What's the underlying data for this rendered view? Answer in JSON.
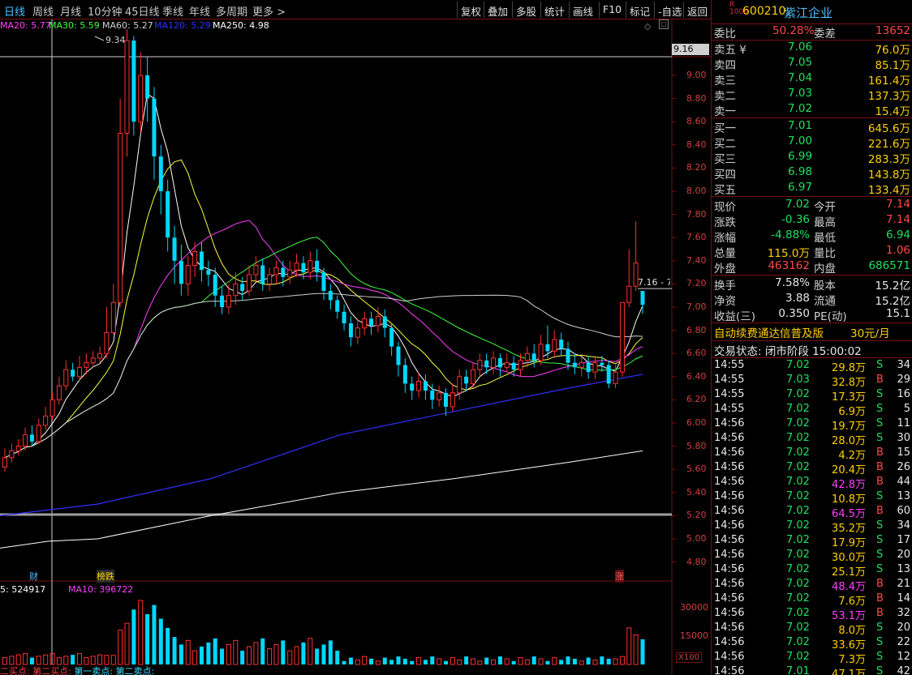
{
  "toolbar": {
    "periods": [
      "日线",
      "周线",
      "月线",
      "10分钟",
      "45日线",
      "季线",
      "年线",
      "多周期",
      "更多 >"
    ],
    "buttons": [
      "复权",
      "叠加",
      "多股",
      "统计",
      "画线",
      "F10",
      "标记",
      "-自选",
      "返回"
    ]
  },
  "ma_legend": {
    "ma20": "MA20: 5.77",
    "ma30": "MA30: 5.59",
    "ma60": "MA60: 5.27",
    "ma120": "MA120: 5.29",
    "ma250": "MA250: 4.98"
  },
  "chart_labels": {
    "high_mark": "9.34",
    "price_cursor": "9.16",
    "last_price_tag": "7.16 - 7",
    "event_cai": "财",
    "event_bang": "榜跌",
    "event_zhang": "涨",
    "vol_legend_ma5": "5: 524917",
    "vol_legend_ma10": "MA10: 396722",
    "vol_unit": "X100",
    "bottom_signals": [
      "二买点:",
      "第二买点:",
      "第一卖点:",
      "第二卖点:"
    ]
  },
  "chart_data": {
    "type": "candlestick",
    "y_ticks": [
      "9.00",
      "8.80",
      "8.60",
      "8.40",
      "8.20",
      "8.00",
      "7.80",
      "7.60",
      "7.40",
      "7.20",
      "7.00",
      "6.80",
      "6.60",
      "6.40",
      "6.20",
      "6.00",
      "5.80",
      "5.60",
      "5.40",
      "5.20",
      "5.00",
      "4.80"
    ],
    "vol_ticks": [
      "30000",
      "15000"
    ],
    "ylim": [
      4.7,
      9.45
    ]
  },
  "stock": {
    "r_mark": "R",
    "r_sub": "1000",
    "code": "600210",
    "name": "紫江企业"
  },
  "order_book": {
    "weibi_label": "委比",
    "weibi_value": "50.28%",
    "weicha_label": "委差",
    "weicha_value": "13652",
    "asks": [
      {
        "label": "卖五 ¥",
        "price": "7.06",
        "vol": "76.0万"
      },
      {
        "label": "卖四",
        "price": "7.05",
        "vol": "85.1万"
      },
      {
        "label": "卖三",
        "price": "7.04",
        "vol": "161.4万"
      },
      {
        "label": "卖二",
        "price": "7.03",
        "vol": "137.3万"
      },
      {
        "label": "卖一",
        "price": "7.02",
        "vol": "15.4万"
      }
    ],
    "bids": [
      {
        "label": "买一",
        "price": "7.01",
        "vol": "645.6万"
      },
      {
        "label": "买二",
        "price": "7.00",
        "vol": "221.6万"
      },
      {
        "label": "买三",
        "price": "6.99",
        "vol": "283.3万"
      },
      {
        "label": "买四",
        "price": "6.98",
        "vol": "143.8万"
      },
      {
        "label": "买五",
        "price": "6.97",
        "vol": "133.4万"
      }
    ]
  },
  "quote": [
    {
      "l1": "现价",
      "v1": "7.02",
      "l2": "今开",
      "v2": "7.14"
    },
    {
      "l1": "涨跌",
      "v1": "-0.36",
      "l2": "最高",
      "v2": "7.14"
    },
    {
      "l1": "涨幅",
      "v1": "-4.88%",
      "l2": "最低",
      "v2": "6.94"
    },
    {
      "l1": "总量",
      "v1": "115.0万",
      "l2": "量比",
      "v2": "1.06"
    },
    {
      "l1": "外盘",
      "v1": "463162",
      "l2": "内盘",
      "v2": "686571"
    }
  ],
  "finance": [
    {
      "l1": "换手",
      "v1": "7.58%",
      "l2": "股本",
      "v2": "15.2亿"
    },
    {
      "l1": "净资",
      "v1": "3.88",
      "l2": "流通",
      "v2": "15.2亿"
    },
    {
      "l1": "收益(三)",
      "v1": "0.350",
      "l2": "PE(动)",
      "v2": "15.1"
    }
  ],
  "promo": {
    "text": "自动续费通达信普及版",
    "price": "30元/月"
  },
  "trade_status": "交易状态: 闭市阶段 15:00:02",
  "ticks": [
    {
      "t": "14:55",
      "p": "7.02",
      "v": "29.8万",
      "d": "S",
      "n": "34"
    },
    {
      "t": "14:55",
      "p": "7.03",
      "v": "32.8万",
      "d": "B",
      "n": "29"
    },
    {
      "t": "14:55",
      "p": "7.02",
      "v": "17.3万",
      "d": "S",
      "n": "16"
    },
    {
      "t": "14:55",
      "p": "7.02",
      "v": "6.9万",
      "d": "S",
      "n": "5"
    },
    {
      "t": "14:56",
      "p": "7.02",
      "v": "19.7万",
      "d": "S",
      "n": "11"
    },
    {
      "t": "14:56",
      "p": "7.02",
      "v": "28.0万",
      "d": "S",
      "n": "30"
    },
    {
      "t": "14:56",
      "p": "7.02",
      "v": "4.2万",
      "d": "B",
      "n": "15"
    },
    {
      "t": "14:56",
      "p": "7.02",
      "v": "20.4万",
      "d": "B",
      "n": "26"
    },
    {
      "t": "14:56",
      "p": "7.02",
      "v": "42.8万",
      "d": "B",
      "n": "44"
    },
    {
      "t": "14:56",
      "p": "7.02",
      "v": "10.8万",
      "d": "S",
      "n": "13"
    },
    {
      "t": "14:56",
      "p": "7.02",
      "v": "64.5万",
      "d": "B",
      "n": "60"
    },
    {
      "t": "14:56",
      "p": "7.02",
      "v": "35.2万",
      "d": "S",
      "n": "34"
    },
    {
      "t": "14:56",
      "p": "7.02",
      "v": "17.9万",
      "d": "S",
      "n": "17"
    },
    {
      "t": "14:56",
      "p": "7.02",
      "v": "30.0万",
      "d": "S",
      "n": "20"
    },
    {
      "t": "14:56",
      "p": "7.02",
      "v": "25.1万",
      "d": "S",
      "n": "13"
    },
    {
      "t": "14:56",
      "p": "7.02",
      "v": "48.4万",
      "d": "B",
      "n": "21"
    },
    {
      "t": "14:56",
      "p": "7.02",
      "v": "7.6万",
      "d": "B",
      "n": "14"
    },
    {
      "t": "14:56",
      "p": "7.02",
      "v": "53.1万",
      "d": "B",
      "n": "32"
    },
    {
      "t": "14:56",
      "p": "7.02",
      "v": "8.0万",
      "d": "S",
      "n": "20"
    },
    {
      "t": "14:56",
      "p": "7.02",
      "v": "33.6万",
      "d": "S",
      "n": "22"
    },
    {
      "t": "14:56",
      "p": "7.02",
      "v": "7.3万",
      "d": "S",
      "n": "12"
    },
    {
      "t": "14:56",
      "p": "7.01",
      "v": "47.1万",
      "d": "S",
      "n": "42"
    }
  ],
  "colors": {
    "up": "#ff3030",
    "down": "#00d8ff",
    "ma5": "#ffffff",
    "ma10": "#ffff40",
    "ma20": "#ff40ff",
    "ma30": "#40ff40",
    "ma60": "#d0d0d0",
    "ma120": "#3030ff",
    "ma250": "#ffffff",
    "ask_price": "#20e060",
    "bid_price": "#20e060"
  }
}
